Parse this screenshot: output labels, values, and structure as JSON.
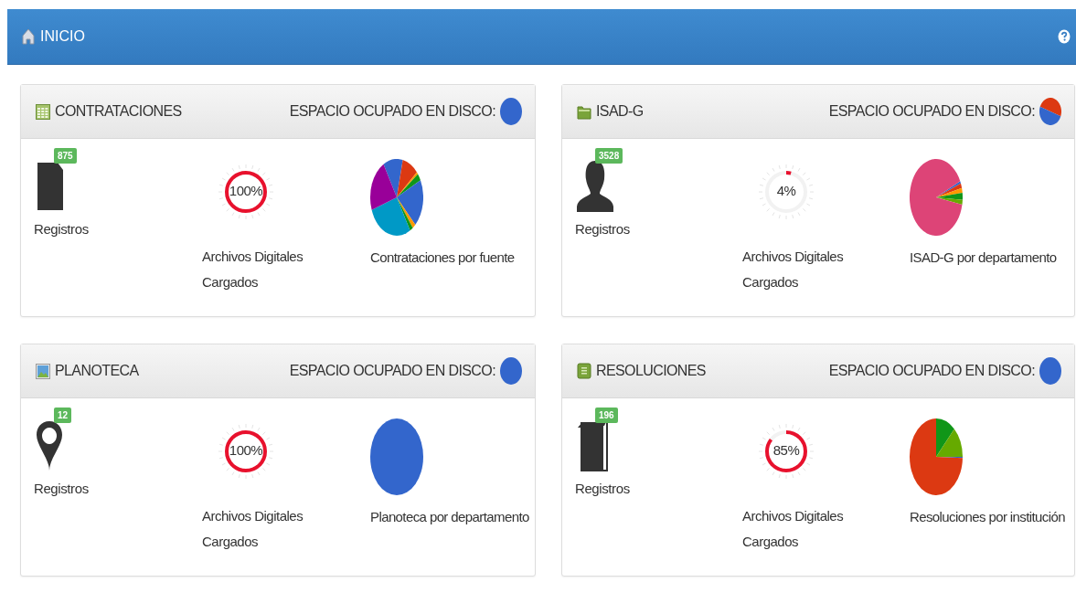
{
  "header": {
    "title": "INICIO"
  },
  "panels": [
    {
      "title": "CONTRATACIONES",
      "disk_label": "ESPACIO OCUPADO EN DISCO:",
      "count": "875",
      "count_label": "Registros",
      "gauge": {
        "level": 1,
        "reading": "100%",
        "label": "Archivos Digitales Cargados"
      },
      "chart_caption": "Contrataciones por fuente"
    },
    {
      "title": "ISAD-G",
      "disk_label": "ESPACIO OCUPADO EN DISCO:",
      "count": "3528",
      "count_label": "Registros",
      "gauge": {
        "level": 0.04,
        "reading": "4%",
        "label": "Archivos Digitales Cargados"
      },
      "chart_caption": "ISAD-G por departamento"
    },
    {
      "title": "PLANOTECA",
      "disk_label": "ESPACIO OCUPADO EN DISCO:",
      "count": "12",
      "count_label": "Registros",
      "gauge": {
        "level": 1,
        "reading": "100%",
        "label": "Archivos Digitales Cargados"
      },
      "chart_caption": "Planoteca por departamento"
    },
    {
      "title": "RESOLUCIONES",
      "disk_label": "ESPACIO OCUPADO EN DISCO:",
      "count": "196",
      "count_label": "Registros",
      "gauge": {
        "level": 0.85,
        "reading": "85%",
        "label": "Archivos Digitales Cargados"
      },
      "chart_caption": "Resoluciones por institución"
    }
  ]
}
